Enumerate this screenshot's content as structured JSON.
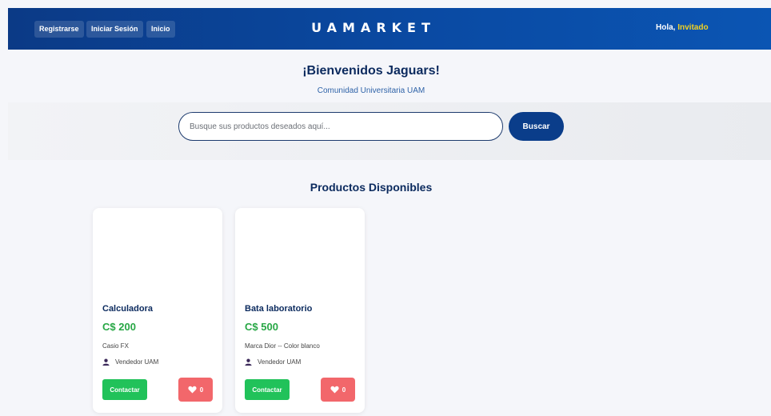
{
  "nav": {
    "register_label": "Registrarse",
    "login_label": "Iniciar Sesión",
    "home_label": "Inicio"
  },
  "brand": {
    "title": "UAMARKET"
  },
  "greeting": {
    "prefix": "Hola,",
    "user": "Invitado"
  },
  "welcome": {
    "title": "¡Bienvenidos Jaguars!",
    "subtitle": "Comunidad Universitaria UAM"
  },
  "search": {
    "placeholder": "Busque sus productos deseados aquí...",
    "button_label": "Buscar"
  },
  "products": {
    "section_title": "Productos Disponibles",
    "items": [
      {
        "title": "Calculadora",
        "price": "C$ 200",
        "description": "Casio FX",
        "seller": "Vendedor UAM",
        "contact_label": "Contactar",
        "likes": "0"
      },
      {
        "title": "Bata laboratorio",
        "price": "C$ 500",
        "description": "Marca Dior -- Color blanco",
        "seller": "Vendedor UAM",
        "contact_label": "Contactar",
        "likes": "0"
      }
    ]
  },
  "icons": {
    "seller": "person-icon",
    "like": "heart-icon"
  },
  "colors": {
    "header_bg": "#0a4aa3",
    "accent_yellow": "#f4d21f",
    "price_green": "#27a745",
    "contact_green": "#21c25a",
    "like_red": "#f2676b",
    "title_navy": "#0b2a5e"
  }
}
